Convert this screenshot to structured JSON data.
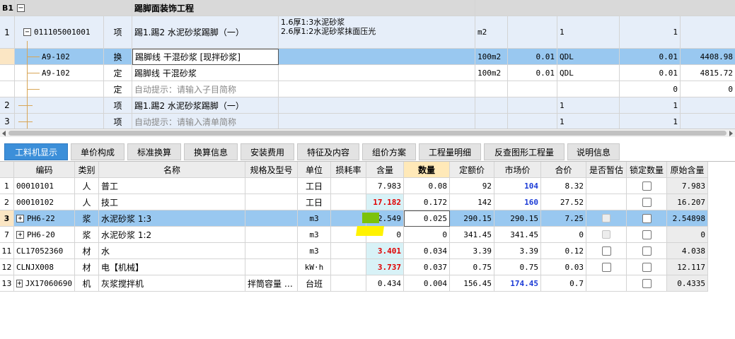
{
  "top_grid": {
    "rows": [
      {
        "num": "B1",
        "code": "",
        "type": "",
        "name": "踢脚面装饰工程",
        "feature": "",
        "unit": "",
        "quantity": "",
        "expr": "",
        "expr2": "",
        "price": ""
      },
      {
        "num": "1",
        "code": "011105001001",
        "type": "项",
        "name": "踢1.踢2 水泥砂浆踢脚（一）",
        "feature": "1.6厚1:3水泥砂浆",
        "feature2": "2.6厚1:2水泥砂浆抹面压光",
        "unit": "m2",
        "quantity": "",
        "expr": "1",
        "expr2": "1",
        "price": ""
      },
      {
        "num": "",
        "code": "A9-102",
        "type": "换",
        "name": "踢脚线 干混砂浆 [现拌砂浆]",
        "feature": "",
        "unit": "100m2",
        "quantity": "0.01",
        "expr": "QDL",
        "expr2": "0.01",
        "price": "4408.98"
      },
      {
        "num": "",
        "code": "A9-102",
        "type": "定",
        "name": "踢脚线 干混砂浆",
        "feature": "",
        "unit": "100m2",
        "quantity": "0.01",
        "expr": "QDL",
        "expr2": "0.01",
        "price": "4815.72"
      },
      {
        "num": "",
        "code": "",
        "type": "定",
        "name": "自动提示：请输入子目简称",
        "feature": "",
        "unit": "",
        "quantity": "",
        "expr": "",
        "expr2": "0",
        "price": "0"
      },
      {
        "num": "2",
        "code": "",
        "type": "项",
        "name": "踢1.踢2 水泥砂浆踢脚（一）",
        "feature": "",
        "unit": "",
        "quantity": "",
        "expr": "1",
        "expr2": "1",
        "price": ""
      },
      {
        "num": "3",
        "code": "",
        "type": "项",
        "name": "自动提示：请输入清单简称",
        "feature": "",
        "unit": "",
        "quantity": "",
        "expr": "1",
        "expr2": "1",
        "price": ""
      }
    ]
  },
  "tabs": [
    "工料机显示",
    "单价构成",
    "标准换算",
    "换算信息",
    "安装费用",
    "特征及内容",
    "组价方案",
    "工程量明细",
    "反查图形工程量",
    "说明信息"
  ],
  "bottom_grid": {
    "headers": [
      "编码",
      "类别",
      "名称",
      "规格及型号",
      "单位",
      "损耗率",
      "含量",
      "数量",
      "定额价",
      "市场价",
      "合价",
      "是否暂估",
      "锁定数量",
      "原始含量"
    ],
    "rows": [
      {
        "num": "1",
        "code": "00010101",
        "cat": "人",
        "name": "普工",
        "spec": "",
        "unit": "工日",
        "loss": "",
        "content": "7.983",
        "qty": "0.08",
        "dprice": "92",
        "mprice": "104",
        "total": "8.32",
        "orig": "7.983"
      },
      {
        "num": "2",
        "code": "00010102",
        "cat": "人",
        "name": "技工",
        "spec": "",
        "unit": "工日",
        "loss": "",
        "content": "17.182",
        "qty": "0.172",
        "dprice": "142",
        "mprice": "160",
        "total": "27.52",
        "orig": "16.207"
      },
      {
        "num": "3",
        "code": "PH6-22",
        "cat": "浆",
        "name": "水泥砂浆 1:3",
        "spec": "",
        "unit": "m3",
        "loss": "",
        "content": "2.549",
        "qty": "0.025",
        "dprice": "290.15",
        "mprice": "290.15",
        "total": "7.25",
        "orig": "2.54898"
      },
      {
        "num": "7",
        "code": "PH6-20",
        "cat": "浆",
        "name": "水泥砂浆 1:2",
        "spec": "",
        "unit": "m3",
        "loss": "",
        "content": "0",
        "qty": "0",
        "dprice": "341.45",
        "mprice": "341.45",
        "total": "0",
        "orig": "0"
      },
      {
        "num": "11",
        "code": "CL17052360",
        "cat": "材",
        "name": "水",
        "spec": "",
        "unit": "m3",
        "loss": "",
        "content": "3.401",
        "qty": "0.034",
        "dprice": "3.39",
        "mprice": "3.39",
        "total": "0.12",
        "orig": "4.038"
      },
      {
        "num": "12",
        "code": "CLNJX008",
        "cat": "材",
        "name": "电【机械】",
        "spec": "",
        "unit": "kW·h",
        "loss": "",
        "content": "3.737",
        "qty": "0.037",
        "dprice": "0.75",
        "mprice": "0.75",
        "total": "0.03",
        "orig": "12.117"
      },
      {
        "num": "13",
        "code": "JX17060690",
        "cat": "机",
        "name": "灰浆搅拌机",
        "spec": "拌筒容量 …",
        "unit": "台班",
        "loss": "",
        "content": "0.434",
        "qty": "0.004",
        "dprice": "156.45",
        "mprice": "174.45",
        "total": "0.7",
        "orig": "0.4335"
      }
    ]
  },
  "colors": {
    "tab_active": "#3c8fd9",
    "selected_row": "#99c8f0",
    "header_bg": "#ececec",
    "red_value": "#e00000",
    "blue_value": "#1b3bd6",
    "marker_green": "#7cc20a",
    "marker_yellow": "#fff200"
  }
}
